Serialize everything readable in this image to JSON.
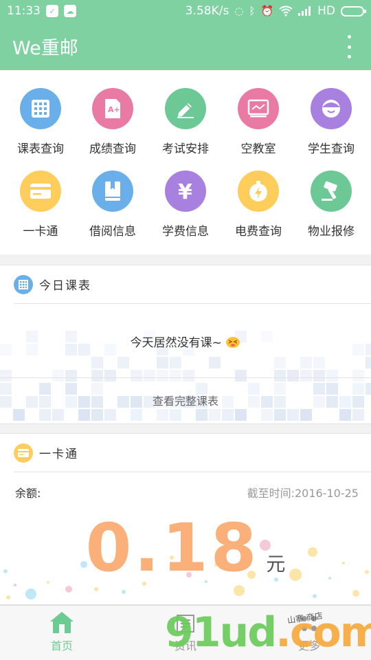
{
  "statusbar": {
    "time": "11:33",
    "speed": "3.58K/s",
    "network": "HD"
  },
  "appbar": {
    "title": "We重邮"
  },
  "grid": [
    {
      "label": "课表查询",
      "icon": "calendar-grid-icon",
      "color": "#6aaeea"
    },
    {
      "label": "成绩查询",
      "icon": "grade-document-icon",
      "color": "#e97aa3"
    },
    {
      "label": "考试安排",
      "icon": "pencil-icon",
      "color": "#6cc996"
    },
    {
      "label": "空教室",
      "icon": "classroom-board-icon",
      "color": "#e97aa3"
    },
    {
      "label": "学生查询",
      "icon": "student-face-icon",
      "color": "#a780e0"
    },
    {
      "label": "一卡通",
      "icon": "card-icon",
      "color": "#ffcd5c"
    },
    {
      "label": "借阅信息",
      "icon": "book-icon",
      "color": "#6aaeea"
    },
    {
      "label": "学费信息",
      "icon": "yen-icon",
      "color": "#a780e0"
    },
    {
      "label": "电费查询",
      "icon": "electricity-bolt-icon",
      "color": "#ffcd5c"
    },
    {
      "label": "物业报修",
      "icon": "hammer-icon",
      "color": "#6cc996"
    }
  ],
  "schedule_card": {
    "title": "今日课表",
    "empty_message": "今天居然没有课~",
    "view_full": "查看完整课表",
    "icon_color": "#6aaeea"
  },
  "card_section": {
    "title": "一卡通",
    "balance_label": "余额:",
    "updated": "截至时间:2016-10-25",
    "amount": "0.18",
    "unit": "元",
    "icon_color": "#ffcd5c"
  },
  "bottom_nav": {
    "home": "首页",
    "news": "资讯",
    "more": "更多"
  },
  "watermark": {
    "text_main": "91ud",
    "text_dot": ".com",
    "sub": "山寨 商店"
  },
  "colors": {
    "primary": "#7fd1a2",
    "active": "#6ccb93",
    "amount": "#fbb07a"
  }
}
